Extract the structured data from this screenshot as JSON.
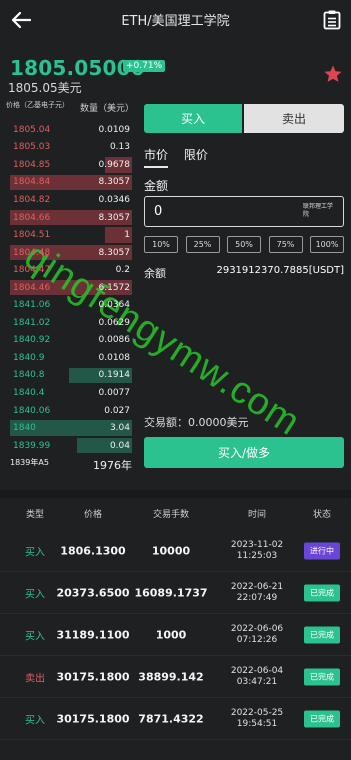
{
  "header": {
    "title": "ETH/美国理工学院"
  },
  "ticker": {
    "price": "1805.05000",
    "change": "+0.71%",
    "price_usd": "1805.05美元"
  },
  "orderbook": {
    "price_header": "价格（乙基电子元）",
    "amount_header": "数量（美元）",
    "sell": [
      {
        "price": "1805.04",
        "qty": "0.0109",
        "depth": 0
      },
      {
        "price": "1805.03",
        "qty": "0.13",
        "depth": 0
      },
      {
        "price": "1804.85",
        "qty": "0.9678",
        "depth": 0.22
      },
      {
        "price": "1804.84",
        "qty": "8.3057",
        "depth": 1.0
      },
      {
        "price": "1804.82",
        "qty": "0.0346",
        "depth": 0
      },
      {
        "price": "1804.66",
        "qty": "8.3057",
        "depth": 1.0
      },
      {
        "price": "1804.51",
        "qty": "1",
        "depth": 0.22
      },
      {
        "price": "1804.48",
        "qty": "8.3057",
        "depth": 1.0
      },
      {
        "price": "1804.47",
        "qty": "0.2",
        "depth": 0
      },
      {
        "price": "1804.46",
        "qty": "6.1572",
        "depth": 1.0
      }
    ],
    "buy": [
      {
        "price": "1841.06",
        "qty": "0.0364",
        "depth": 0
      },
      {
        "price": "1841.02",
        "qty": "0.0629",
        "depth": 0
      },
      {
        "price": "1840.92",
        "qty": "0.0086",
        "depth": 0
      },
      {
        "price": "1840.9",
        "qty": "0.0108",
        "depth": 0
      },
      {
        "price": "1840.8",
        "qty": "0.1914",
        "depth": 0.52
      },
      {
        "price": "1840.4",
        "qty": "0.0077",
        "depth": 0
      },
      {
        "price": "1840.06",
        "qty": "0.027",
        "depth": 0
      },
      {
        "price": "1840",
        "qty": "3.04",
        "depth": 1.0
      },
      {
        "price": "1839.99",
        "qty": "0.04",
        "depth": 0.45
      }
    ],
    "last_price": "1839年A5",
    "last_volume": "1976年"
  },
  "trade": {
    "buy_tab": "买入",
    "sell_tab": "卖出",
    "market_tab": "市价",
    "limit_tab": "限价",
    "amount_label": "金额",
    "amount_value": "0",
    "amount_unit": "联邦理工学院",
    "percents": [
      "10%",
      "25%",
      "50%",
      "75%",
      "100%"
    ],
    "balance_label": "余额",
    "balance_value": "2931912370.7885[USDT]",
    "txn_label": "交易额：0.0000美元",
    "submit_label": "买入/做多"
  },
  "history": {
    "headers": [
      "类型",
      "价格",
      "交易手数",
      "时间",
      "状态"
    ],
    "rows": [
      {
        "type": "买入",
        "side": "buy",
        "price": "1806.1300",
        "qty": "10000",
        "date": "2023-11-02",
        "time": "11:25:03",
        "status": "进行中",
        "status_kind": "progress"
      },
      {
        "type": "买入",
        "side": "buy",
        "price": "20373.6500",
        "qty": "16089.1737",
        "date": "2022-06-21",
        "time": "22:07:49",
        "status": "已完成",
        "status_kind": "done"
      },
      {
        "type": "买入",
        "side": "buy",
        "price": "31189.1100",
        "qty": "1000",
        "date": "2022-06-06",
        "time": "07:12:26",
        "status": "已完成",
        "status_kind": "done"
      },
      {
        "type": "卖出",
        "side": "sell",
        "price": "30175.1800",
        "qty": "38899.142",
        "date": "2022-06-04",
        "time": "03:47:21",
        "status": "已完成",
        "status_kind": "done"
      },
      {
        "type": "买入",
        "side": "buy",
        "price": "30175.1800",
        "qty": "7871.4322",
        "date": "2022-05-25",
        "time": "19:54:51",
        "status": "已完成",
        "status_kind": "done"
      }
    ]
  },
  "watermark": "qingfengymw.com",
  "colors": {
    "up": "#2bc28f",
    "down": "#e05f5f",
    "progress": "#6a46d8",
    "bg": "#1f2022"
  }
}
